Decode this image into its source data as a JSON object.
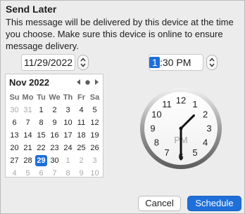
{
  "dialog": {
    "title": "Send Later",
    "description": "This message will be delivered by this device at the time you choose. Make sure this device is online to ensure message delivery."
  },
  "date_field": {
    "value": "11/29/2022"
  },
  "time_field": {
    "highlighted": "1",
    "rest": ":30 PM"
  },
  "calendar": {
    "month_label": "Nov 2022",
    "weekdays": [
      "Su",
      "Mo",
      "Tu",
      "We",
      "Th",
      "Fr",
      "Sa"
    ],
    "weeks": [
      [
        {
          "d": "30",
          "o": true
        },
        {
          "d": "31",
          "o": true
        },
        {
          "d": "1"
        },
        {
          "d": "2"
        },
        {
          "d": "3"
        },
        {
          "d": "4"
        },
        {
          "d": "5"
        }
      ],
      [
        {
          "d": "6"
        },
        {
          "d": "7"
        },
        {
          "d": "8"
        },
        {
          "d": "9"
        },
        {
          "d": "10"
        },
        {
          "d": "11"
        },
        {
          "d": "12"
        }
      ],
      [
        {
          "d": "13"
        },
        {
          "d": "14"
        },
        {
          "d": "15"
        },
        {
          "d": "16"
        },
        {
          "d": "17"
        },
        {
          "d": "18"
        },
        {
          "d": "19"
        }
      ],
      [
        {
          "d": "20"
        },
        {
          "d": "21"
        },
        {
          "d": "22"
        },
        {
          "d": "23"
        },
        {
          "d": "24"
        },
        {
          "d": "25"
        },
        {
          "d": "26"
        }
      ],
      [
        {
          "d": "27"
        },
        {
          "d": "28"
        },
        {
          "d": "29",
          "sel": true
        },
        {
          "d": "30"
        },
        {
          "d": "1",
          "o": true
        },
        {
          "d": "2",
          "o": true
        },
        {
          "d": "3",
          "o": true
        }
      ],
      [
        {
          "d": "4",
          "o": true
        },
        {
          "d": "5",
          "o": true
        },
        {
          "d": "6",
          "o": true
        },
        {
          "d": "7",
          "o": true
        },
        {
          "d": "8",
          "o": true
        },
        {
          "d": "9",
          "o": true
        },
        {
          "d": "10",
          "o": true
        }
      ]
    ],
    "prev_icon": "triangle-left-icon",
    "today_icon": "dot-icon",
    "next_icon": "triangle-right-icon"
  },
  "clock": {
    "numbers": [
      "12",
      "1",
      "2",
      "3",
      "4",
      "5",
      "6",
      "7",
      "8",
      "9",
      "10",
      "11"
    ],
    "period": "PM",
    "hour": 1,
    "minute": 30
  },
  "buttons": {
    "cancel": "Cancel",
    "schedule": "Schedule"
  },
  "colors": {
    "accent": "#1f6fd9",
    "dialog_bg": "#ececec"
  }
}
